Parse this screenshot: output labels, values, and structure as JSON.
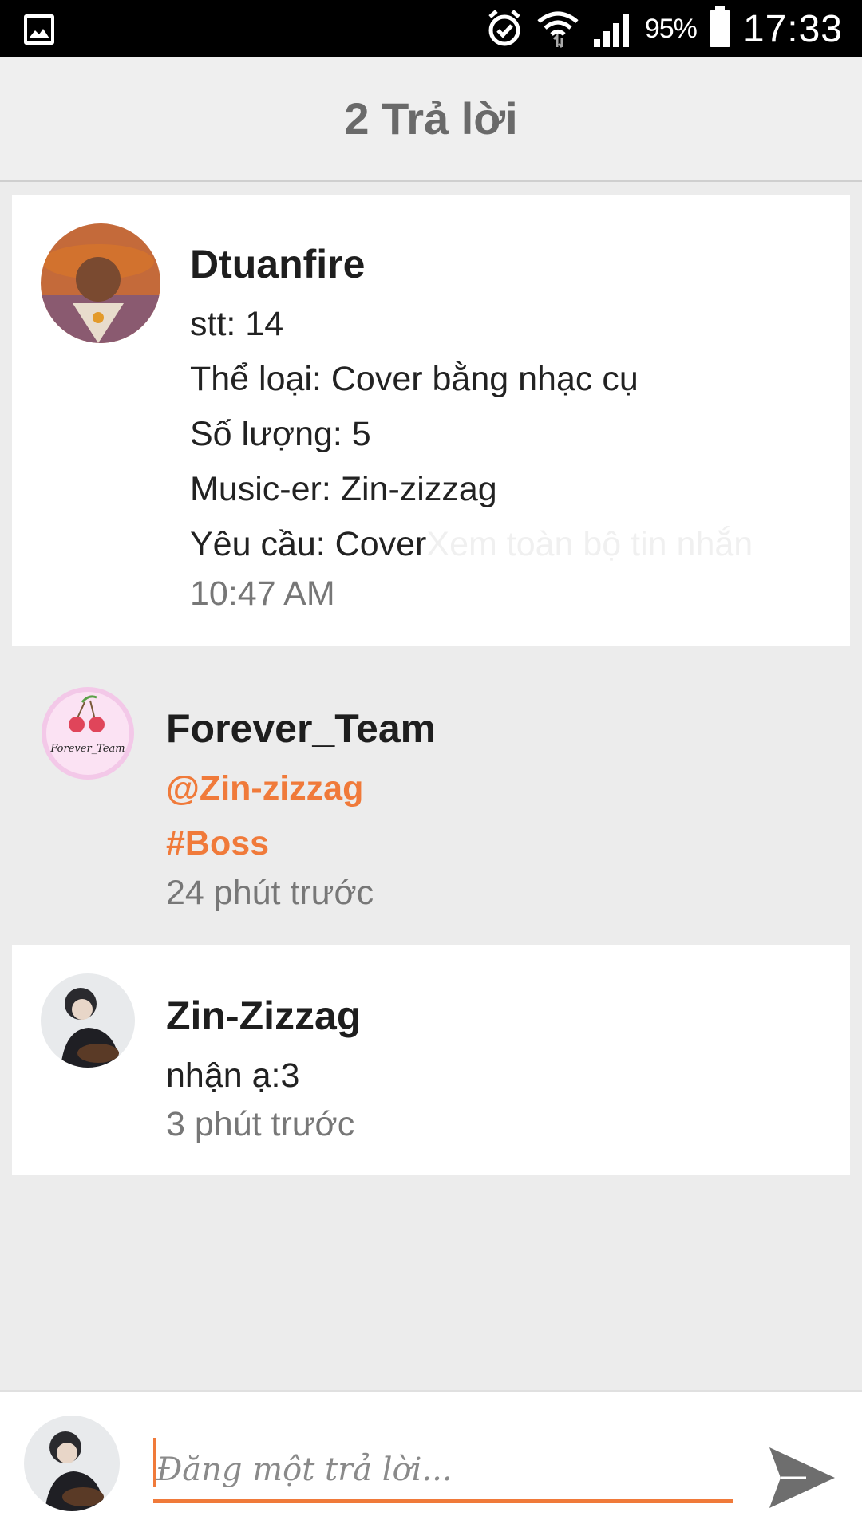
{
  "status_bar": {
    "battery": "95%",
    "time": "17:33"
  },
  "header": {
    "title": "2 Trả lời"
  },
  "original_post": {
    "author": "Dtuanfire",
    "lines": [
      "stt: 14",
      "Thể loại: Cover bằng nhạc cụ",
      "Số lượng: 5",
      "Music-er: Zin-zizzag"
    ],
    "last_line": "Yêu cầu: Cover",
    "see_all": "Xem toàn bộ tin nhắn",
    "time": "10:47 AM"
  },
  "replies": [
    {
      "author": "Forever_Team",
      "mention": "@Zin-zizzag",
      "hashtag": "#Boss",
      "time": "24 phút trước",
      "avatar_text": "Forever_Team"
    },
    {
      "author": "Zin-Zizzag",
      "text": "nhận ạ:3",
      "time": "3 phút trước"
    }
  ],
  "reply_box": {
    "placeholder": "Đăng một trả lời..."
  },
  "colors": {
    "accent": "#f07a3a",
    "background": "#ececec"
  },
  "icons": [
    "gallery-icon",
    "alarm-icon",
    "wifi-icon",
    "signal-icon",
    "battery-icon",
    "send-icon"
  ]
}
